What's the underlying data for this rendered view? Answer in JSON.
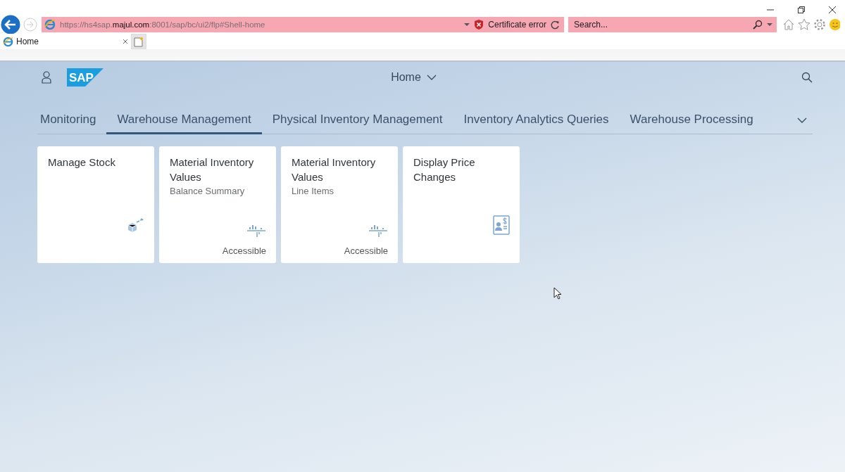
{
  "browser": {
    "address": "https://hs4sap.**majul.com**:8001/sap/bc/ui2/flp#Shell-home",
    "certificate": "Certificate error",
    "search": {
      "placeholder": "Search..."
    },
    "tabs": [
      {
        "label": "Home",
        "selected": true
      }
    ]
  },
  "shell": {
    "logo": "SAP",
    "title": "Home"
  },
  "tabs": [
    {
      "label": "Monitoring",
      "selected": false
    },
    {
      "label": "Warehouse Management",
      "selected": true
    },
    {
      "label": "Physical Inventory Management",
      "selected": false
    },
    {
      "label": "Inventory Analytics Queries",
      "selected": false
    },
    {
      "label": "Warehouse Processing",
      "selected": false
    }
  ],
  "tiles": [
    {
      "title": "Manage Stock",
      "kind": "stock"
    },
    {
      "title": "Material Inventory Values",
      "subtitle": "Balance Summary",
      "kind": "chart",
      "footer": "Accessible"
    },
    {
      "title": "Material Inventory Values",
      "subtitle": "Line Items",
      "kind": "chart",
      "footer": "Accessible"
    },
    {
      "title": "Display Price Changes",
      "kind": "price"
    }
  ]
}
